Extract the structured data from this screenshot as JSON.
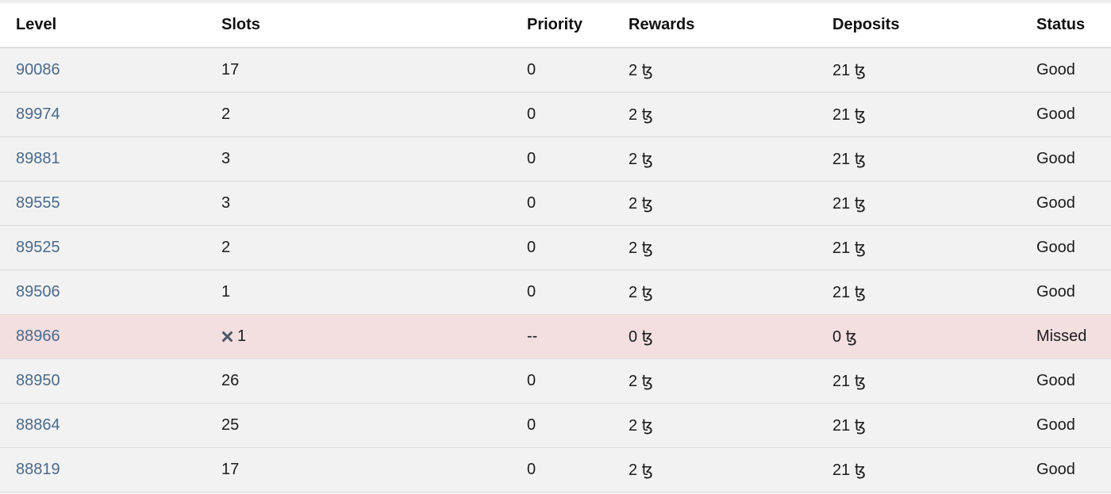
{
  "table": {
    "headers": {
      "level": "Level",
      "slots": "Slots",
      "priority": "Priority",
      "rewards": "Rewards",
      "deposits": "Deposits",
      "status": "Status"
    },
    "rows": [
      {
        "level": "90086",
        "slots": "17",
        "priority": "0",
        "rewards": "2 ꜩ",
        "deposits": "21 ꜩ",
        "status": "Good"
      },
      {
        "level": "89974",
        "slots": "2",
        "priority": "0",
        "rewards": "2 ꜩ",
        "deposits": "21 ꜩ",
        "status": "Good"
      },
      {
        "level": "89881",
        "slots": "3",
        "priority": "0",
        "rewards": "2 ꜩ",
        "deposits": "21 ꜩ",
        "status": "Good"
      },
      {
        "level": "89555",
        "slots": "3",
        "priority": "0",
        "rewards": "2 ꜩ",
        "deposits": "21 ꜩ",
        "status": "Good"
      },
      {
        "level": "89525",
        "slots": "2",
        "priority": "0",
        "rewards": "2 ꜩ",
        "deposits": "21 ꜩ",
        "status": "Good"
      },
      {
        "level": "89506",
        "slots": "1",
        "priority": "0",
        "rewards": "2 ꜩ",
        "deposits": "21 ꜩ",
        "status": "Good"
      },
      {
        "level": "88966",
        "slots": "1",
        "slot_icon": "x-icon",
        "priority": "--",
        "rewards": "0 ꜩ",
        "deposits": "0 ꜩ",
        "status": "Missed"
      },
      {
        "level": "88950",
        "slots": "26",
        "priority": "0",
        "rewards": "2 ꜩ",
        "deposits": "21 ꜩ",
        "status": "Good"
      },
      {
        "level": "88864",
        "slots": "25",
        "priority": "0",
        "rewards": "2 ꜩ",
        "deposits": "21 ꜩ",
        "status": "Good"
      },
      {
        "level": "88819",
        "slots": "17",
        "priority": "0",
        "rewards": "2 ꜩ",
        "deposits": "21 ꜩ",
        "status": "Good"
      }
    ]
  },
  "colors": {
    "link": "#4a6a8a",
    "row_background": "#f2f2f2",
    "missed_row_background": "#f3dfe0",
    "header_background": "#ffffff"
  }
}
